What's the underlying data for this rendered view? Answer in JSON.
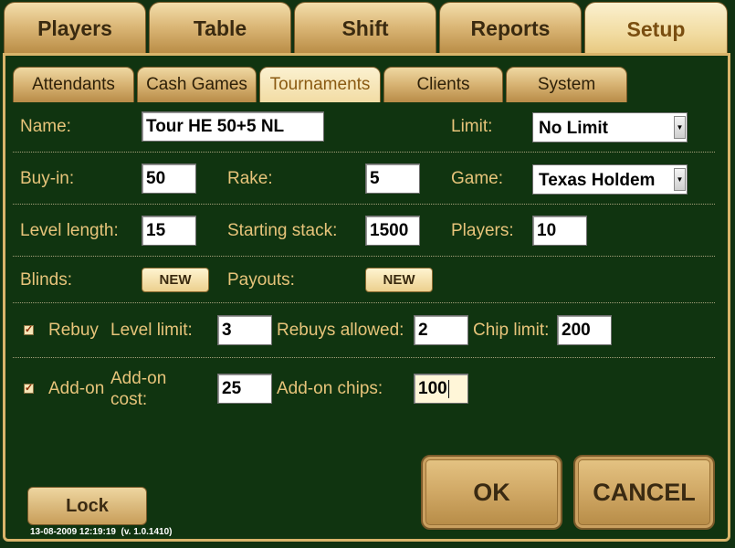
{
  "top_tabs": [
    {
      "label": "Players",
      "active": false
    },
    {
      "label": "Table",
      "active": false
    },
    {
      "label": "Shift",
      "active": false
    },
    {
      "label": "Reports",
      "active": false
    },
    {
      "label": "Setup",
      "active": true
    }
  ],
  "sub_tabs": [
    {
      "label": "Attendants",
      "active": false
    },
    {
      "label": "Cash Games",
      "active": false
    },
    {
      "label": "Tournaments",
      "active": true
    },
    {
      "label": "Clients",
      "active": false
    },
    {
      "label": "System",
      "active": false
    }
  ],
  "form": {
    "name_label": "Name:",
    "name_value": "Tour HE 50+5 NL",
    "limit_label": "Limit:",
    "limit_value": "No Limit",
    "buyin_label": "Buy-in:",
    "buyin_value": "50",
    "rake_label": "Rake:",
    "rake_value": "5",
    "game_label": "Game:",
    "game_value": "Texas Holdem",
    "level_length_label": "Level length:",
    "level_length_value": "15",
    "starting_stack_label": "Starting stack:",
    "starting_stack_value": "1500",
    "players_label": "Players:",
    "players_value": "10",
    "blinds_label": "Blinds:",
    "blinds_button": "NEW",
    "payouts_label": "Payouts:",
    "payouts_button": "NEW",
    "rebuy_checked": true,
    "rebuy_label": "Rebuy",
    "level_limit_label": "Level limit:",
    "level_limit_value": "3",
    "rebuys_allowed_label": "Rebuys allowed:",
    "rebuys_allowed_value": "2",
    "chip_limit_label": "Chip limit:",
    "chip_limit_value": "200",
    "addon_checked": true,
    "addon_label": "Add-on",
    "addon_cost_label_line1": "Add-on",
    "addon_cost_label_line2": "cost:",
    "addon_cost_value": "25",
    "addon_chips_label": "Add-on chips:",
    "addon_chips_value": "100"
  },
  "actions": {
    "ok_label": "OK",
    "cancel_label": "CANCEL",
    "lock_label": "Lock"
  },
  "status": {
    "timestamp": "13-08-2009 12:19:19",
    "version": "(v. 1.0.1410)"
  },
  "icons": {
    "checkbox_check": "check-icon",
    "dropdown_arrow": "dropdown-arrow-icon"
  }
}
